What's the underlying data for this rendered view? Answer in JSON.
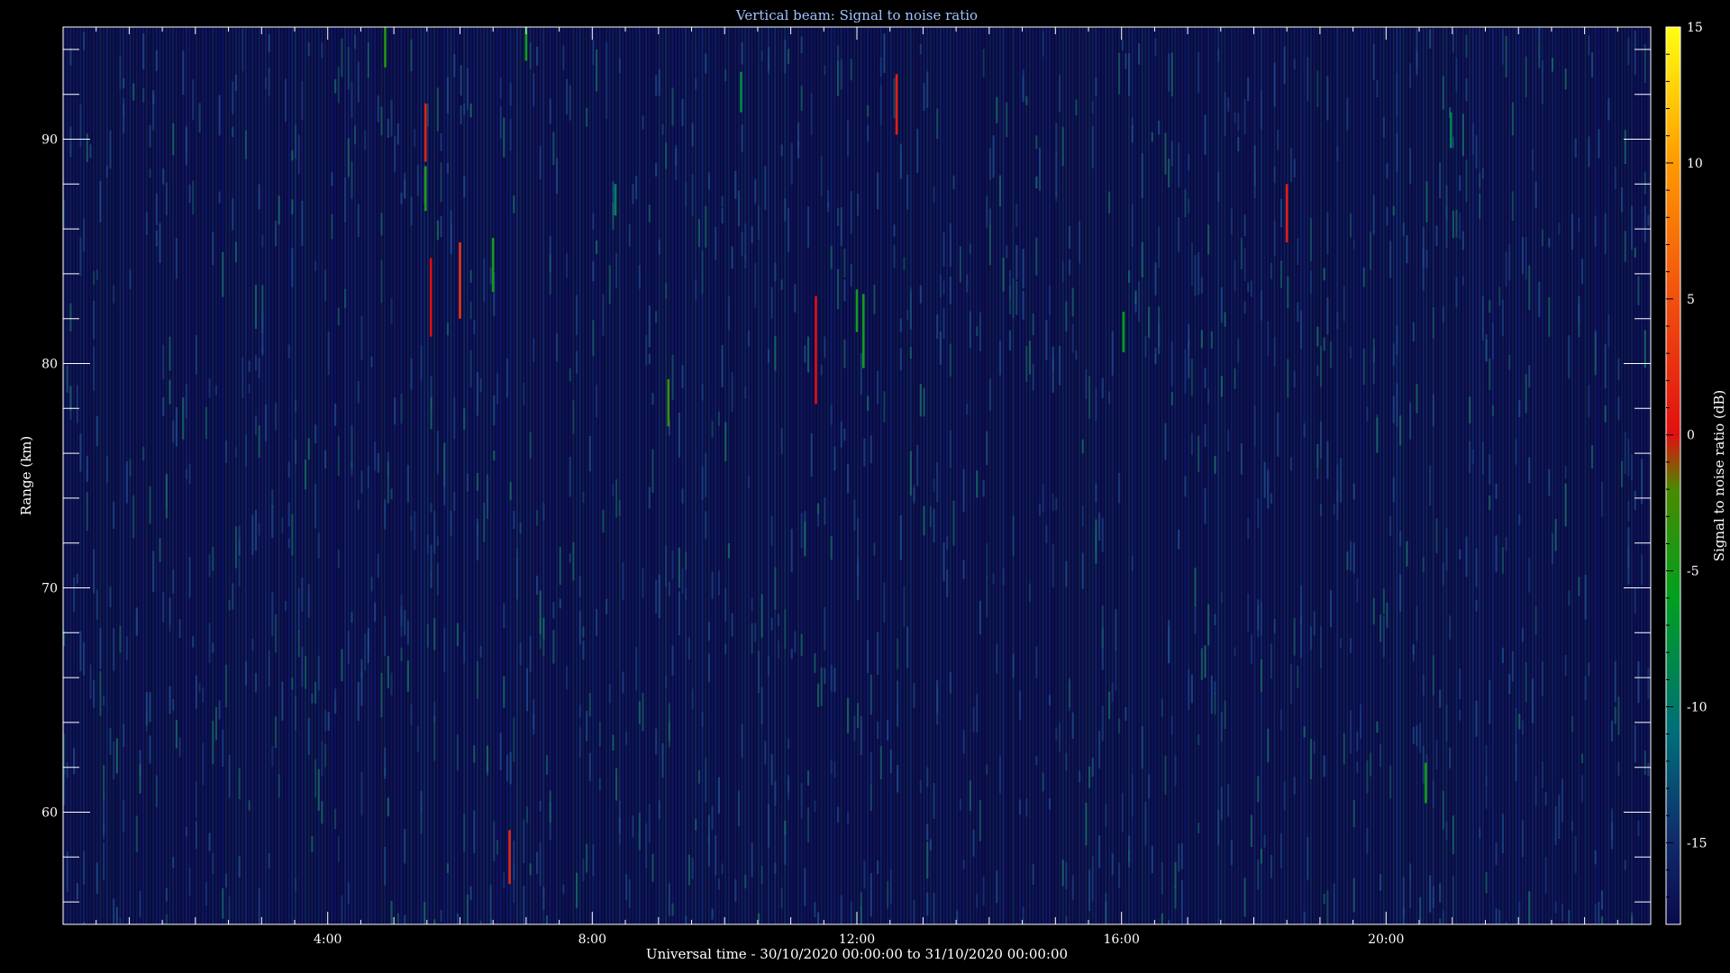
{
  "chart_data": {
    "type": "heatmap",
    "title": "Vertical beam: Signal to noise ratio",
    "xlabel": "Universal time - 30/10/2020 00:00:00 to 31/10/2020 00:00:00",
    "ylabel": "Range (km)",
    "colorbar_label": "Signal to noise ratio (dB)",
    "xlim_hours": [
      0,
      24
    ],
    "ylim_km": [
      55,
      95
    ],
    "x_ticks": [
      {
        "label": "4:00",
        "hour": 4
      },
      {
        "label": "8:00",
        "hour": 8
      },
      {
        "label": "12:00",
        "hour": 12
      },
      {
        "label": "16:00",
        "hour": 16
      },
      {
        "label": "20:00",
        "hour": 20
      }
    ],
    "y_ticks": [
      60,
      70,
      80,
      90
    ],
    "colorbar_range": [
      -18,
      15
    ],
    "colorbar_ticks": [
      15,
      10,
      5,
      0,
      -5,
      -10,
      -15
    ],
    "background_snr_db": -15,
    "colormap": [
      {
        "db": -18,
        "color": "#0a0a4a"
      },
      {
        "db": -15,
        "color": "#102a6a"
      },
      {
        "db": -11,
        "color": "#006d7a"
      },
      {
        "db": -6,
        "color": "#00a020"
      },
      {
        "db": -2,
        "color": "#4a8a00"
      },
      {
        "db": 0,
        "color": "#e01010"
      },
      {
        "db": 5,
        "color": "#f05010"
      },
      {
        "db": 10,
        "color": "#ff9900"
      },
      {
        "db": 15,
        "color": "#ffff10"
      }
    ],
    "echoes": [
      {
        "hour": 4.87,
        "range_lo": 93.2,
        "range_hi": 95.0,
        "snr_db": -4
      },
      {
        "hour": 5.48,
        "range_lo": 89.0,
        "range_hi": 91.6,
        "snr_db": 1
      },
      {
        "hour": 5.48,
        "range_lo": 86.8,
        "range_hi": 88.8,
        "snr_db": -4
      },
      {
        "hour": 5.56,
        "range_lo": 81.2,
        "range_hi": 84.7,
        "snr_db": 0
      },
      {
        "hour": 6.0,
        "range_lo": 82.0,
        "range_hi": 85.4,
        "snr_db": 3
      },
      {
        "hour": 6.5,
        "range_lo": 83.2,
        "range_hi": 85.6,
        "snr_db": -5
      },
      {
        "hour": 7.0,
        "range_lo": 93.5,
        "range_hi": 95.0,
        "snr_db": -5
      },
      {
        "hour": 6.75,
        "range_lo": 56.8,
        "range_hi": 59.2,
        "snr_db": 2
      },
      {
        "hour": 9.15,
        "range_lo": 77.2,
        "range_hi": 79.3,
        "snr_db": -3
      },
      {
        "hour": 11.38,
        "range_lo": 78.2,
        "range_hi": 83.0,
        "snr_db": 0
      },
      {
        "hour": 12.0,
        "range_lo": 81.4,
        "range_hi": 83.3,
        "snr_db": -5
      },
      {
        "hour": 12.1,
        "range_lo": 79.8,
        "range_hi": 83.1,
        "snr_db": -5
      },
      {
        "hour": 12.6,
        "range_lo": 90.2,
        "range_hi": 92.9,
        "snr_db": 1
      },
      {
        "hour": 16.03,
        "range_lo": 80.5,
        "range_hi": 82.3,
        "snr_db": -6
      },
      {
        "hour": 18.5,
        "range_lo": 85.4,
        "range_hi": 88.0,
        "snr_db": 1
      },
      {
        "hour": 20.6,
        "range_lo": 60.4,
        "range_hi": 62.2,
        "snr_db": -5
      },
      {
        "hour": 10.25,
        "range_lo": 91.2,
        "range_hi": 93.0,
        "snr_db": -8
      },
      {
        "hour": 8.35,
        "range_lo": 86.6,
        "range_hi": 88.0,
        "snr_db": -9
      },
      {
        "hour": 20.98,
        "range_lo": 89.6,
        "range_hi": 91.2,
        "snr_db": -9
      }
    ]
  }
}
